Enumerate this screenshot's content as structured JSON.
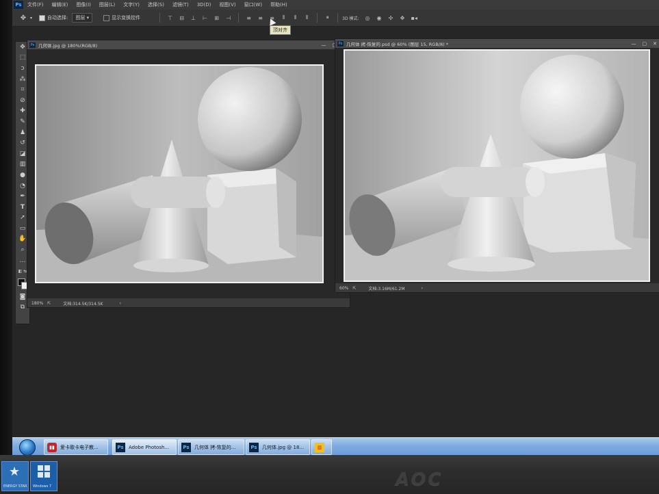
{
  "menubar": {
    "app_icon": "Ps",
    "items": [
      "文件(F)",
      "编辑(E)",
      "图像(I)",
      "图层(L)",
      "文字(Y)",
      "选择(S)",
      "滤镜(T)",
      "3D(D)",
      "视图(V)",
      "窗口(W)",
      "帮助(H)"
    ]
  },
  "options_bar": {
    "auto_select_label": "自动选择:",
    "auto_select_value": "图层",
    "show_transform_label": "显示变换控件",
    "tooltip": "顶对齐"
  },
  "documents": [
    {
      "title": "几何体.jpg @ 180%(RGB/8)",
      "zoom": "180%",
      "doc_size": "文档:314.5K/314.5K"
    },
    {
      "title": "几何体 拷-恢复的.psd @ 60% (图层 15, RGB/8) *",
      "zoom": "60%",
      "doc_size": "文档:3.16M/61.2M"
    }
  ],
  "taskbar": {
    "items": [
      {
        "label": "爱卡歌卡电子教...",
        "icon": "red-app-icon"
      },
      {
        "label": "Adobe Photosh...",
        "icon": "ps-icon"
      },
      {
        "label": "几何体 拷-恢复的...",
        "icon": "ps-icon"
      },
      {
        "label": "几何体.jpg @ 18...",
        "icon": "ps-icon"
      },
      {
        "label": "",
        "icon": "chart-app-icon"
      }
    ]
  },
  "bezel": {
    "brand": "AOC",
    "energy_star_text": "ENERGY STAR",
    "windows_badge_text": "Windows 7"
  }
}
